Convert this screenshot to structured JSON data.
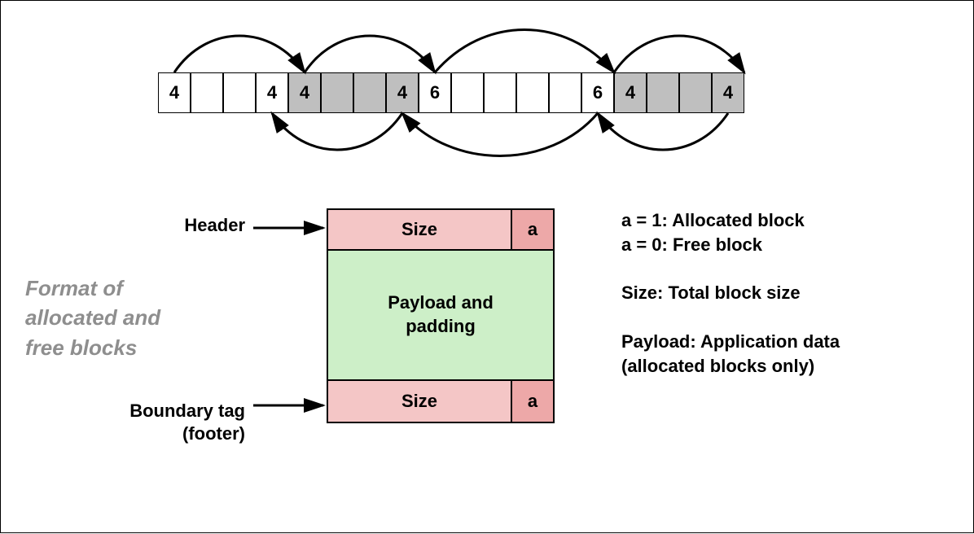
{
  "heap": {
    "cells": [
      {
        "v": "4",
        "shaded": false
      },
      {
        "v": "",
        "shaded": false
      },
      {
        "v": "",
        "shaded": false
      },
      {
        "v": "4",
        "shaded": false
      },
      {
        "v": "4",
        "shaded": true
      },
      {
        "v": "",
        "shaded": true
      },
      {
        "v": "",
        "shaded": true
      },
      {
        "v": "4",
        "shaded": true
      },
      {
        "v": "6",
        "shaded": false
      },
      {
        "v": "",
        "shaded": false
      },
      {
        "v": "",
        "shaded": false
      },
      {
        "v": "",
        "shaded": false
      },
      {
        "v": "",
        "shaded": false
      },
      {
        "v": "6",
        "shaded": false
      },
      {
        "v": "4",
        "shaded": true
      },
      {
        "v": "",
        "shaded": true
      },
      {
        "v": "",
        "shaded": true
      },
      {
        "v": "4",
        "shaded": true
      }
    ]
  },
  "block": {
    "header_label": "Header",
    "footer_label_line1": "Boundary tag",
    "footer_label_line2": "(footer)",
    "size_label": "Size",
    "a_label": "a",
    "payload_line1": "Payload and",
    "payload_line2": "padding"
  },
  "caption": {
    "line1": "Format of",
    "line2": "allocated and",
    "line3": "free blocks"
  },
  "legend": {
    "a1": "a = 1: Allocated block",
    "a0": "a = 0: Free block",
    "size": "Size: Total block size",
    "payload_line1": "Payload: Application data",
    "payload_line2": "(allocated blocks only)"
  }
}
